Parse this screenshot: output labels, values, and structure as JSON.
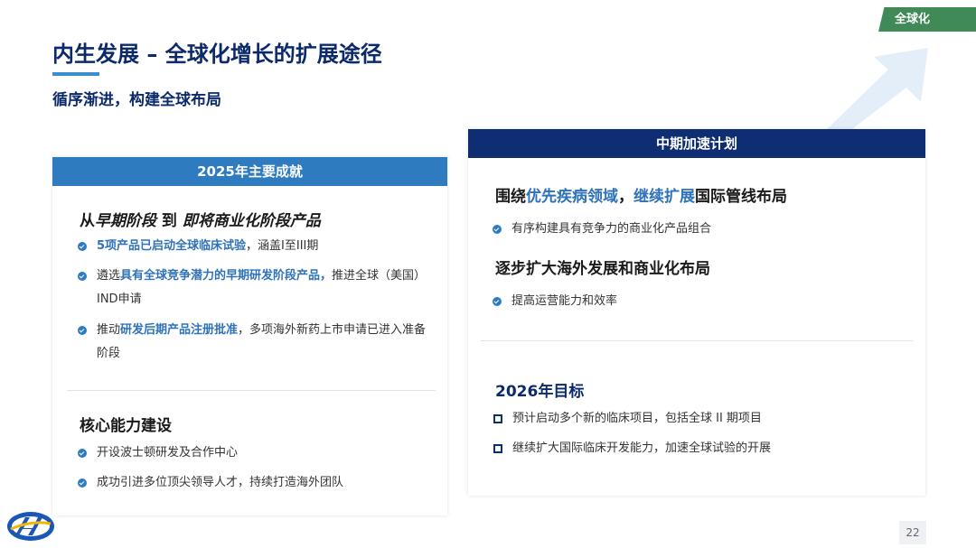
{
  "tag": "全球化",
  "title": "内生发展 – 全球化增长的扩展途径",
  "subtitle": "循序渐进，构建全球布局",
  "left": {
    "header": "2025年主要成就",
    "section1": {
      "p1": "从",
      "p2": "早期阶段",
      "p3": " 到 ",
      "p4": "即将商业化阶段产品"
    },
    "bullets1": [
      {
        "b": "5项产品已启动全球临床试验",
        "t": "，涵盖I至III期"
      },
      {
        "a": "遴选",
        "b": "具有全球竞争潜力的早期研发阶段产品，",
        "t": "推进全球（美国）IND申请"
      },
      {
        "a": "推动",
        "b": "研发后期产品注册批准",
        "t": "，多项海外新药上市申请已进入准备阶段"
      }
    ],
    "section2": "核心能力建设",
    "bullets2": [
      "开设波士顿研发及合作中心",
      "成功引进多位顶尖领导人才，持续打造海外团队"
    ]
  },
  "right": {
    "header": "中期加速计划",
    "section1": {
      "p1": "围绕",
      "p2": "优先疾病领域",
      "p3": "，",
      "p4": "继续扩展",
      "p5": "国际管线布局"
    },
    "bullet1": "有序构建具有竞争力的商业化产品组合",
    "section2": "逐步扩大海外发展和商业化布局",
    "bullet2": "提高运营能力和效率",
    "section3": "2026年目标",
    "targets": [
      "预计启动多个新的临床项目，包括全球 II 期项目",
      "继续扩大国际临床开发能力，加速全球试验的开展"
    ]
  },
  "page_number": "22",
  "colors": {
    "navy": "#0c2a6b",
    "blue": "#2e7bc0",
    "green": "#3f8a57",
    "dark_header": "#0e2d72"
  }
}
